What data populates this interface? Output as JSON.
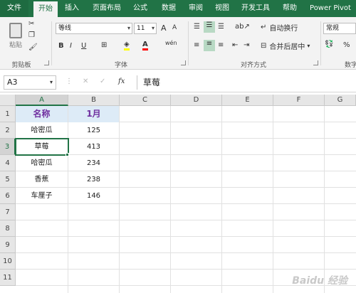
{
  "tabs": [
    "文件",
    "开始",
    "插入",
    "页面布局",
    "公式",
    "数据",
    "审阅",
    "视图",
    "开发工具",
    "帮助",
    "Power Pivot"
  ],
  "active_tab": "开始",
  "ribbon": {
    "clipboard": {
      "paste_label": "粘贴",
      "group_label": "剪贴板"
    },
    "font": {
      "font_name": "等线",
      "font_size": "11",
      "grow": "A",
      "shrink": "A",
      "bold": "B",
      "italic": "I",
      "underline": "U",
      "phonetic": "wén",
      "group_label": "字体"
    },
    "alignment": {
      "wrap_text": "自动换行",
      "merge_center": "合并后居中",
      "group_label": "对齐方式"
    },
    "number": {
      "format": "常规",
      "percent": "%",
      "group_label": "数字"
    }
  },
  "formula_bar": {
    "name_box": "A3",
    "fx": "fx",
    "content": "草莓"
  },
  "columns": [
    "A",
    "B",
    "C",
    "D",
    "E",
    "F",
    "G"
  ],
  "rows": [
    "1",
    "2",
    "3",
    "4",
    "5",
    "6",
    "7",
    "8",
    "9",
    "10",
    "11"
  ],
  "sheet": {
    "header": [
      "名称",
      "1月"
    ],
    "data": [
      [
        "哈密瓜",
        "125"
      ],
      [
        "草莓",
        "413"
      ],
      [
        "哈密瓜",
        "234"
      ],
      [
        "香蕉",
        "238"
      ],
      [
        "车厘子",
        "146"
      ]
    ]
  },
  "watermark": "Baidu 经验",
  "colors": {
    "excel_green": "#217346",
    "header_fill": "#ddebf7",
    "header_text": "#7030a0"
  }
}
